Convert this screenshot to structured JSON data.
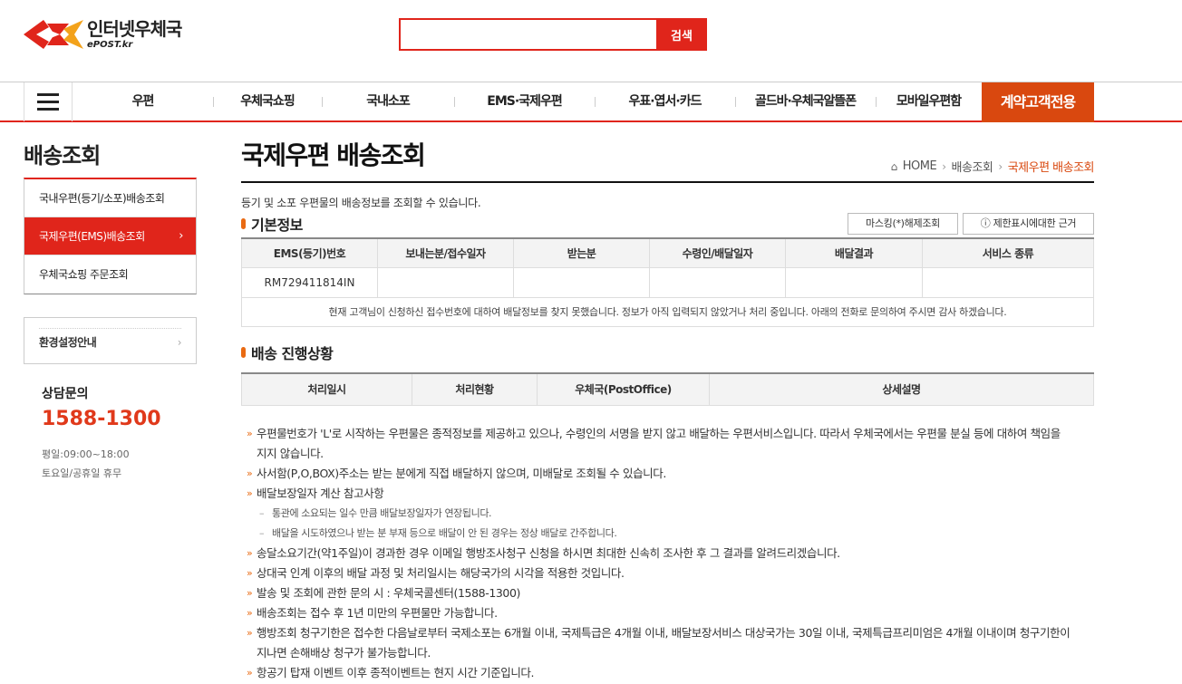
{
  "header": {
    "logo_title": "인터넷우체국",
    "logo_sub": "ePOST.kr",
    "search_placeholder": "",
    "search_button": "검색"
  },
  "gnb": {
    "items": [
      "우편",
      "우체국쇼핑",
      "국내소포",
      "EMS·국제우편",
      "우표·엽서·카드",
      "골드바·우체국알뜰폰",
      "모바일우편함"
    ],
    "special": "계약고객전용"
  },
  "lnb": {
    "title": "배송조회",
    "items": [
      "국내우편(등기/소포)배송조회",
      "국제우편(EMS)배송조회",
      "우체국쇼핑 주문조회"
    ],
    "env_label": "환경설정안내",
    "cs_title": "상담문의",
    "cs_phone": "1588-1300",
    "cs_hours_weekday": "평일:09:00~18:00",
    "cs_hours_weekend": "토요일/공휴일 휴무"
  },
  "content": {
    "title": "국제우편 배송조회",
    "breadcrumb": [
      "HOME",
      "배송조회",
      "국제우편 배송조회"
    ],
    "intro": "등기 및 소포 우편물의 배송정보를 조회할 수 있습니다.",
    "basic_info": {
      "heading": "기본정보",
      "btn_masking": "마스킹(*)해제조회",
      "btn_limit": "ⓘ 제한표시에대한 근거",
      "columns": [
        "EMS(등기)번호",
        "보내는분/접수일자",
        "받는분",
        "수령인/배달일자",
        "배달결과",
        "서비스 종류"
      ],
      "row": [
        "RM729411814IN",
        "",
        "",
        "",
        "",
        ""
      ],
      "message": "현재 고객님이 신청하신 접수번호에 대하여 배달정보를 찾지 못했습니다. 정보가 아직 입력되지 않았거나 처리 중입니다. 아래의 전화로 문의하여 주시면 감사 하겠습니다."
    },
    "progress": {
      "heading": "배송 진행상황",
      "columns": [
        "처리일시",
        "처리현황",
        "우체국(PostOffice)",
        "상세설명"
      ]
    },
    "notes": [
      "우편물번호가 'L'로 시작하는 우편물은 종적정보를 제공하고 있으나, 수령인의 서명을 받지 않고 배달하는 우편서비스입니다. 따라서 우체국에서는 우편물 분실 등에 대하여 책임을",
      "지지 않습니다.",
      "사서함(P,O,BOX)주소는 받는 분에게 직접 배달하지 않으며, 미배달로 조회될 수 있습니다.",
      "배달보장일자 계산 참고사항",
      "통관에 소요되는 일수 만큼 배달보장일자가 연장됩니다.",
      "배달을 시도하였으나 받는 분 부재 등으로 배달이 안 된 경우는 정상 배달로 간주합니다.",
      "송달소요기간(약1주일)이 경과한 경우 이메일 행방조사청구 신청을 하시면 최대한 신속히 조사한 후 그 결과를 알려드리겠습니다.",
      "상대국 인계 이후의 배달 과정 및 처리일시는 해당국가의 시각을 적용한 것입니다.",
      "발송 및 조회에 관한 문의 시 : 우체국콜센터(1588-1300)",
      "배송조회는 접수 후 1년 미만의 우편물만 가능합니다.",
      "행방조회 청구기한은 접수한 다음날로부터 국제소포는 6개월 이내, 국제특급은 4개월 이내, 배달보장서비스 대상국가는 30일 이내, 국제특급프리미엄은 4개월 이내이며 청구기한이",
      "지나면 손해배상 청구가 불가능합니다.",
      "항공기 탑재 이벤트 이후 종적이벤트는 현지 시간 기준입니다."
    ]
  },
  "colors": {
    "brand_red": "#e0251b",
    "accent_orange": "#d9480f"
  }
}
